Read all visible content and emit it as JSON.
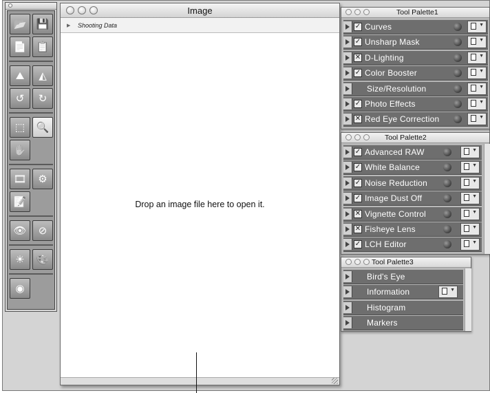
{
  "image_window": {
    "title": "Image",
    "shooting_data_label": "Shooting Data",
    "drop_message": "Drop an image file here to open it."
  },
  "toolbar": {
    "buttons": [
      {
        "name": "open-folder-icon",
        "selected": false
      },
      {
        "name": "save-disk-icon",
        "selected": false
      },
      {
        "name": "copy-document-icon",
        "selected": false
      },
      {
        "name": "paste-document-icon",
        "selected": false
      },
      {
        "name": "mountain-small-icon",
        "selected": false
      },
      {
        "name": "mountain-flat-icon",
        "selected": false
      },
      {
        "name": "rotate-left-icon",
        "selected": false
      },
      {
        "name": "rotate-right-icon",
        "selected": false
      },
      {
        "name": "marquee-select-icon",
        "selected": false
      },
      {
        "name": "zoom-magnifier-icon",
        "selected": true
      },
      {
        "name": "hand-tool-icon",
        "selected": false
      },
      {
        "name": "filmstrip-icon",
        "selected": false
      },
      {
        "name": "batch-process-icon",
        "selected": false
      },
      {
        "name": "edit-list-icon",
        "selected": false
      },
      {
        "name": "red-eye-tool-icon",
        "selected": false
      },
      {
        "name": "prohibit-circle-icon",
        "selected": false
      },
      {
        "name": "brightness-sun-icon",
        "selected": false
      },
      {
        "name": "palette-brush-icon",
        "selected": false
      },
      {
        "name": "eye-preview-icon",
        "selected": false
      }
    ]
  },
  "palette1": {
    "title": "Tool Palette1",
    "items": [
      {
        "label": "Curves",
        "check": "check",
        "menu": true
      },
      {
        "label": "Unsharp Mask",
        "check": "check",
        "menu": true
      },
      {
        "label": "D-Lighting",
        "check": "x",
        "menu": true
      },
      {
        "label": "Color Booster",
        "check": "check",
        "menu": true
      },
      {
        "label": "Size/Resolution",
        "check": "none",
        "menu": true
      },
      {
        "label": "Photo Effects",
        "check": "check",
        "menu": true
      },
      {
        "label": "Red Eye Correction",
        "check": "x",
        "menu": true
      }
    ]
  },
  "palette2": {
    "title": "Tool Palette2",
    "items": [
      {
        "label": "Advanced RAW",
        "check": "check",
        "menu": true
      },
      {
        "label": "White Balance",
        "check": "check",
        "menu": true
      },
      {
        "label": "Noise Reduction",
        "check": "check",
        "menu": true
      },
      {
        "label": "Image Dust Off",
        "check": "check",
        "menu": true
      },
      {
        "label": "Vignette Control",
        "check": "x",
        "menu": true
      },
      {
        "label": "Fisheye Lens",
        "check": "x",
        "menu": true
      },
      {
        "label": "LCH Editor",
        "check": "check",
        "menu": true
      }
    ]
  },
  "palette3": {
    "title": "Tool Palette3",
    "items": [
      {
        "label": "Bird's Eye",
        "menu": false
      },
      {
        "label": "Information",
        "menu": true
      },
      {
        "label": "Histogram",
        "menu": false
      },
      {
        "label": "Markers",
        "menu": false
      }
    ]
  }
}
